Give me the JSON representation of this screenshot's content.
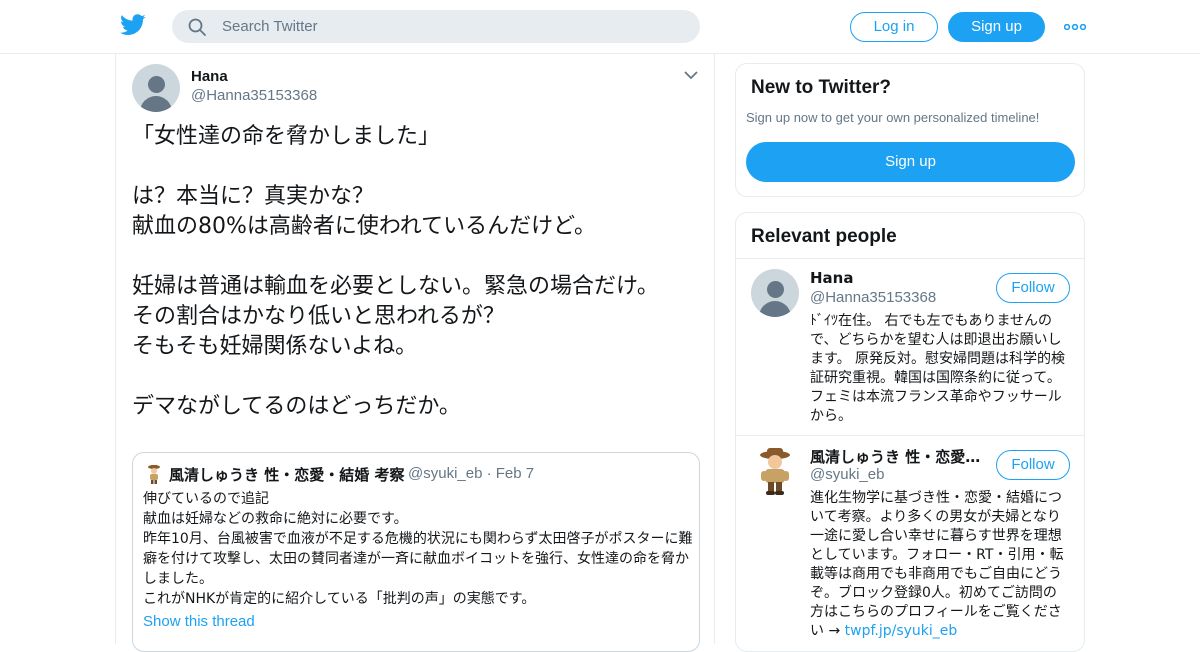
{
  "header": {
    "search_placeholder": "Search Twitter",
    "login_label": "Log in",
    "signup_label": "Sign up",
    "brand_color": "#1da1f2"
  },
  "tweet": {
    "author_name": "Hana",
    "author_handle": "@Hanna35153368",
    "text": "「女性達の命を脅かしました」\n\nは？本当に？真実かな？\n献血の80%は高齢者に使われているんだけど。\n\n妊婦は普通は輸血を必要としない。緊急の場合だけ。\nその割合はかなり低いと思われるが？\nそもそも妊婦関係ないよね。\n\nデマながしてるのはどっちだか。",
    "quote": {
      "author_name": "風清しゅうき 性・恋愛・結婚 考察",
      "author_handle": "@syuki_eb · Feb 7",
      "text": "伸びているので追記\n献血は妊婦などの救命に絶対に必要です。\n昨年10月、台風被害で血液が不足する危機的状況にも関わらず太田啓子がポスターに難癖を付けて攻撃し、太田の賛同者達が一斉に献血ボイコットを強行、女性達の命を脅かしました。\nこれがNHKが肯定的に紹介している「批判の声」の実態です。",
      "show_thread": "Show this thread"
    }
  },
  "sidebar": {
    "new_card": {
      "title": "New to Twitter?",
      "subtitle": "Sign up now to get your own personalized timeline!",
      "signup_label": "Sign up"
    },
    "people": {
      "title": "Relevant people",
      "items": [
        {
          "name": "Hana",
          "handle": "@Hanna35153368",
          "follow_label": "Follow",
          "bio": "ﾄﾞｲﾂ在住。 右でも左でもありませんので、どちらかを望む人は即退出お願いします。 原発反対。慰安婦問題は科学的検証研究重視。韓国は国際条約に従って。フェミは本流フランス革命やフッサールから。"
        },
        {
          "name": "風清しゅうき 性・恋愛…",
          "handle": "@syuki_eb",
          "follow_label": "Follow",
          "bio": "進化生物学に基づき性・恋愛・結婚について考察。より多くの男女が夫婦となり一途に愛し合い幸せに暮らす世界を理想としています。フォロー・RT・引用・転載等は商用でも非商用でもご自由にどうぞ。ブロック登録0人。初めてご訪問の方はこちらのプロフィールをご覧ください → ",
          "bio_link": "twpf.jp/syuki_eb"
        }
      ]
    }
  }
}
